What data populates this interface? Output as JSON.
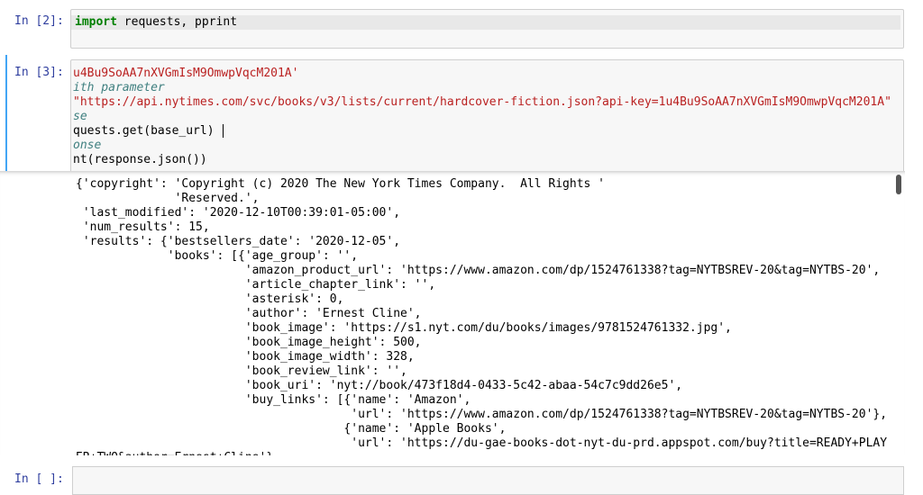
{
  "cells": {
    "c2": {
      "prompt": "In [2]:",
      "tokens": [
        {
          "t": "import",
          "k": "kw"
        },
        {
          "t": " requests, pprint",
          "k": ""
        }
      ]
    },
    "c3": {
      "prompt": "In [3]:",
      "lines": [
        [
          {
            "t": "u4Bu9SoAA7nXVGmIsM9OmwpVqcM201A'",
            "k": "str"
          }
        ],
        [
          {
            "t": "ith parameter",
            "k": "cmt"
          }
        ],
        [
          {
            "t": "\"https://api.nytimes.com/svc/books/v3/lists/current/hardcover-fiction.json?api-key=1u4Bu9SoAA7nXVGmIsM9OmwpVqcM201A\"",
            "k": "str"
          }
        ],
        [
          {
            "t": "se",
            "k": "cmt"
          }
        ],
        [
          {
            "t": "quests.get(base_url) ",
            "k": ""
          }
        ],
        [
          {
            "t": "onse",
            "k": "cmt"
          }
        ],
        [
          {
            "t": "nt(response.json())",
            "k": ""
          }
        ]
      ]
    },
    "c4": {
      "prompt": "In [ ]:"
    }
  },
  "output_lines": [
    "{'copyright': 'Copyright (c) 2020 The New York Times Company.  All Rights '",
    "              'Reserved.',",
    " 'last_modified': '2020-12-10T00:39:01-05:00',",
    " 'num_results': 15,",
    " 'results': {'bestsellers_date': '2020-12-05',",
    "             'books': [{'age_group': '',",
    "                        'amazon_product_url': 'https://www.amazon.com/dp/1524761338?tag=NYTBSREV-20&tag=NYTBS-20',",
    "                        'article_chapter_link': '',",
    "                        'asterisk': 0,",
    "                        'author': 'Ernest Cline',",
    "                        'book_image': 'https://s1.nyt.com/du/books/images/9781524761332.jpg',",
    "                        'book_image_height': 500,",
    "                        'book_image_width': 328,",
    "                        'book_review_link': '',",
    "                        'book_uri': 'nyt://book/473f18d4-0433-5c42-abaa-54c7c9dd26e5',",
    "                        'buy_links': [{'name': 'Amazon',",
    "                                       'url': 'https://www.amazon.com/dp/1524761338?tag=NYTBSREV-20&tag=NYTBS-20'},",
    "                                      {'name': 'Apple Books',",
    "                                       'url': 'https://du-gae-books-dot-nyt-du-prd.appspot.com/buy?title=READY+PLAY",
    "ER+TWO&author=Ernest+Cline'}"
  ]
}
